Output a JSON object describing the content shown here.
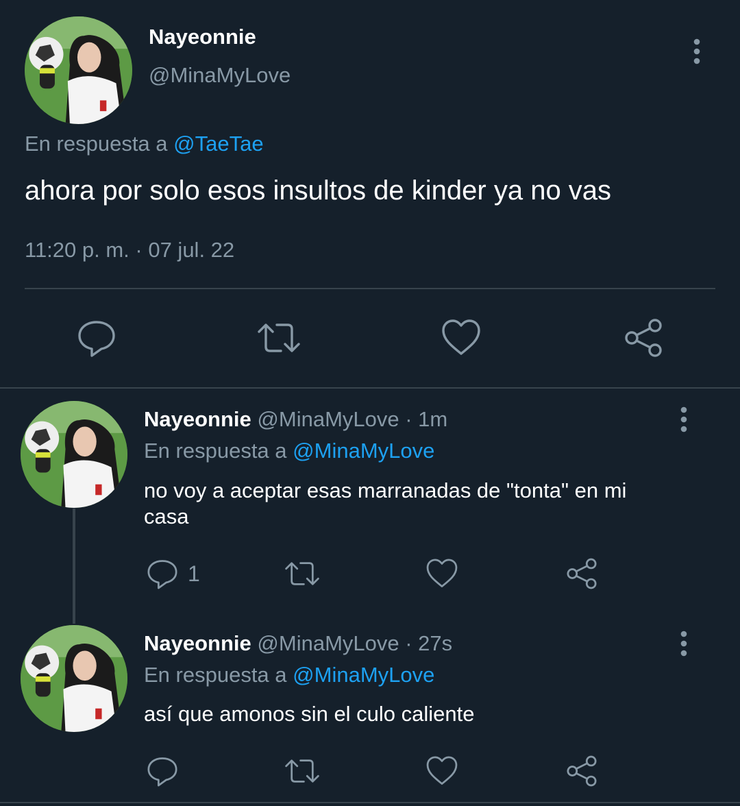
{
  "main_tweet": {
    "display_name": "Nayeonnie",
    "handle": "@MinaMyLove",
    "reply_prefix": "En respuesta a",
    "reply_to": "@TaeTae",
    "text": "ahora por solo esos insultos de kinder ya no vas",
    "timestamp": "11:20 p. m. · 07 jul. 22",
    "actions": [
      "reply-icon",
      "retweet-icon",
      "like-icon",
      "share-icon"
    ]
  },
  "replies": [
    {
      "display_name": "Nayeonnie",
      "meta": "@MinaMyLove · 1m",
      "reply_prefix": "En respuesta a",
      "reply_to": "@MinaMyLove",
      "text_line1": "no voy a aceptar esas marranadas de \"tonta\" en mi",
      "text_line2": "casa",
      "reply_count": "1"
    },
    {
      "display_name": "Nayeonnie",
      "meta": "@MinaMyLove · 27s",
      "reply_prefix": "En respuesta a",
      "reply_to": "@MinaMyLove",
      "text": "así que amonos sin el culo caliente"
    }
  ],
  "colors": {
    "background": "#15202b",
    "muted": "#8899a6",
    "link": "#1da1f2",
    "divider": "#38444d"
  }
}
